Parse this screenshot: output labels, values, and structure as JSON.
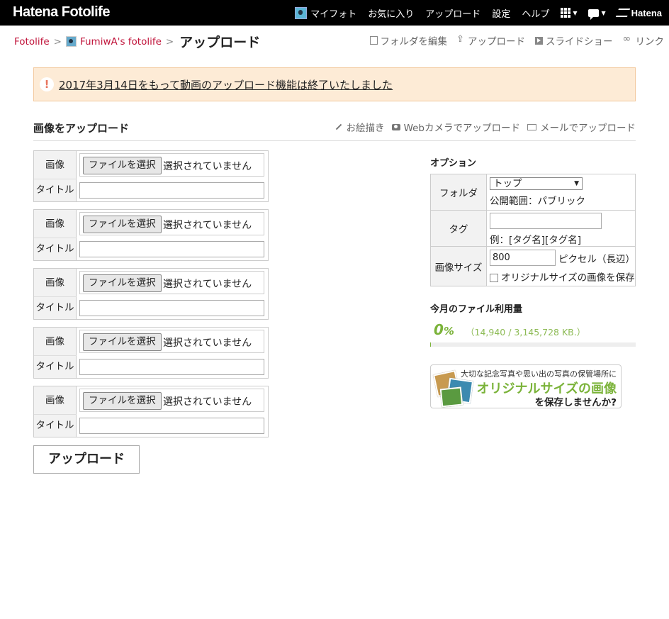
{
  "topbar": {
    "logo": "Hatena Fotolife",
    "nav": [
      "マイフォト",
      "お気に入り",
      "アップロード",
      "設定",
      "ヘルプ"
    ],
    "brand": "Hatena"
  },
  "breadcrumb": {
    "root": "Fotolife",
    "user": "FumiwA's fotolife",
    "current": "アップロード"
  },
  "toolbar": [
    "フォルダを編集",
    "アップロード",
    "スライドショー",
    "リンク"
  ],
  "notice": {
    "icon": "!",
    "text": "2017年3月14日をもって動画のアップロード機能は終了いたしました"
  },
  "upload": {
    "heading": "画像をアップロード",
    "links": [
      "お絵描き",
      "Webカメラでアップロード",
      "メールでアップロード"
    ],
    "image_label": "画像",
    "title_label": "タイトル",
    "file_button": "ファイルを選択",
    "file_status": "選択されていません",
    "slots": 5,
    "submit": "アップロード"
  },
  "options": {
    "heading": "オプション",
    "folder_label": "フォルダ",
    "folder_value": "トップ",
    "visibility": "公開範囲：パブリック",
    "tag_label": "タグ",
    "tag_example": "例：[タグ名][タグ名]",
    "size_label": "画像サイズ",
    "size_value": "800",
    "size_unit": "ピクセル（長辺）",
    "keep_original": "オリジナルサイズの画像を保存"
  },
  "usage": {
    "heading": "今月のファイル利用量",
    "percent_number": "0",
    "percent_sign": "%",
    "detail": "（14,940 / 3,145,728 KB.）",
    "fraction": 0.0047
  },
  "banner": {
    "line1": "大切な記念写真や思い出の写真の保管場所に",
    "line2": "オリジナルサイズの画像",
    "line3": "を保存しませんか?"
  },
  "colors": {
    "topbar_bg": "#000000",
    "link_red": "#c0133a",
    "notice_bg": "#fdebd6",
    "usage_green": "#7bb33a"
  }
}
